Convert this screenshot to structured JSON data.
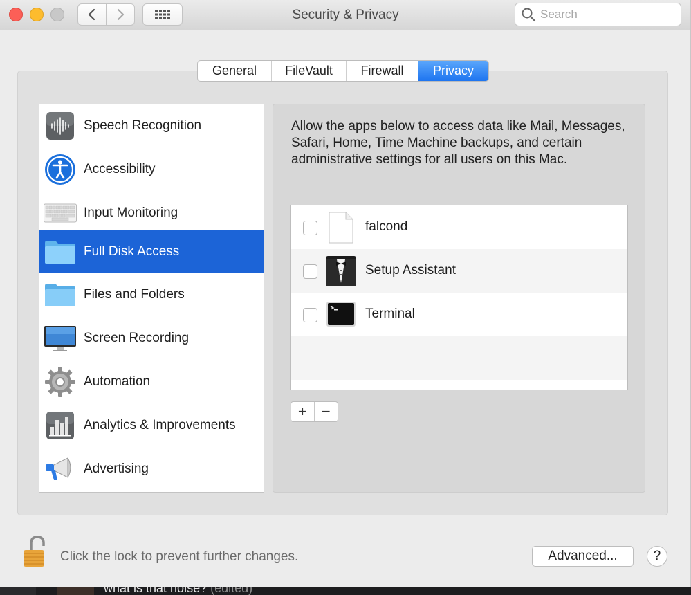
{
  "window": {
    "title": "Security & Privacy",
    "search_placeholder": "Search"
  },
  "tabs": [
    {
      "label": "General",
      "active": false
    },
    {
      "label": "FileVault",
      "active": false
    },
    {
      "label": "Firewall",
      "active": false
    },
    {
      "label": "Privacy",
      "active": true
    }
  ],
  "categories": [
    {
      "label": "Speech Recognition",
      "icon": "speech-recognition-icon",
      "selected": false
    },
    {
      "label": "Accessibility",
      "icon": "accessibility-icon",
      "selected": false
    },
    {
      "label": "Input Monitoring",
      "icon": "keyboard-icon",
      "selected": false
    },
    {
      "label": "Full Disk Access",
      "icon": "folder-icon",
      "selected": true
    },
    {
      "label": "Files and Folders",
      "icon": "folder-icon",
      "selected": false
    },
    {
      "label": "Screen Recording",
      "icon": "display-icon",
      "selected": false
    },
    {
      "label": "Automation",
      "icon": "gear-icon",
      "selected": false
    },
    {
      "label": "Analytics & Improvements",
      "icon": "bar-chart-icon",
      "selected": false
    },
    {
      "label": "Advertising",
      "icon": "megaphone-icon",
      "selected": false
    }
  ],
  "pane": {
    "description": "Allow the apps below to access data like Mail, Messages, Safari, Home, Time Machine backups, and certain administrative settings for all users on this Mac.",
    "apps": [
      {
        "name": "falcond",
        "checked": false,
        "icon": "document-icon"
      },
      {
        "name": "Setup Assistant",
        "checked": false,
        "icon": "tuxedo-icon"
      },
      {
        "name": "Terminal",
        "checked": false,
        "icon": "terminal-icon"
      }
    ],
    "add_label": "+",
    "remove_label": "−"
  },
  "footer": {
    "lock_text": "Click the lock to prevent further changes.",
    "advanced_label": "Advanced...",
    "help_label": "?"
  },
  "background_chat": {
    "message": "what is that noise?",
    "edited": "(edited)"
  },
  "colors": {
    "accent": "#1c64d7",
    "close": "#fc5f57",
    "minimize": "#fdbc2e"
  }
}
